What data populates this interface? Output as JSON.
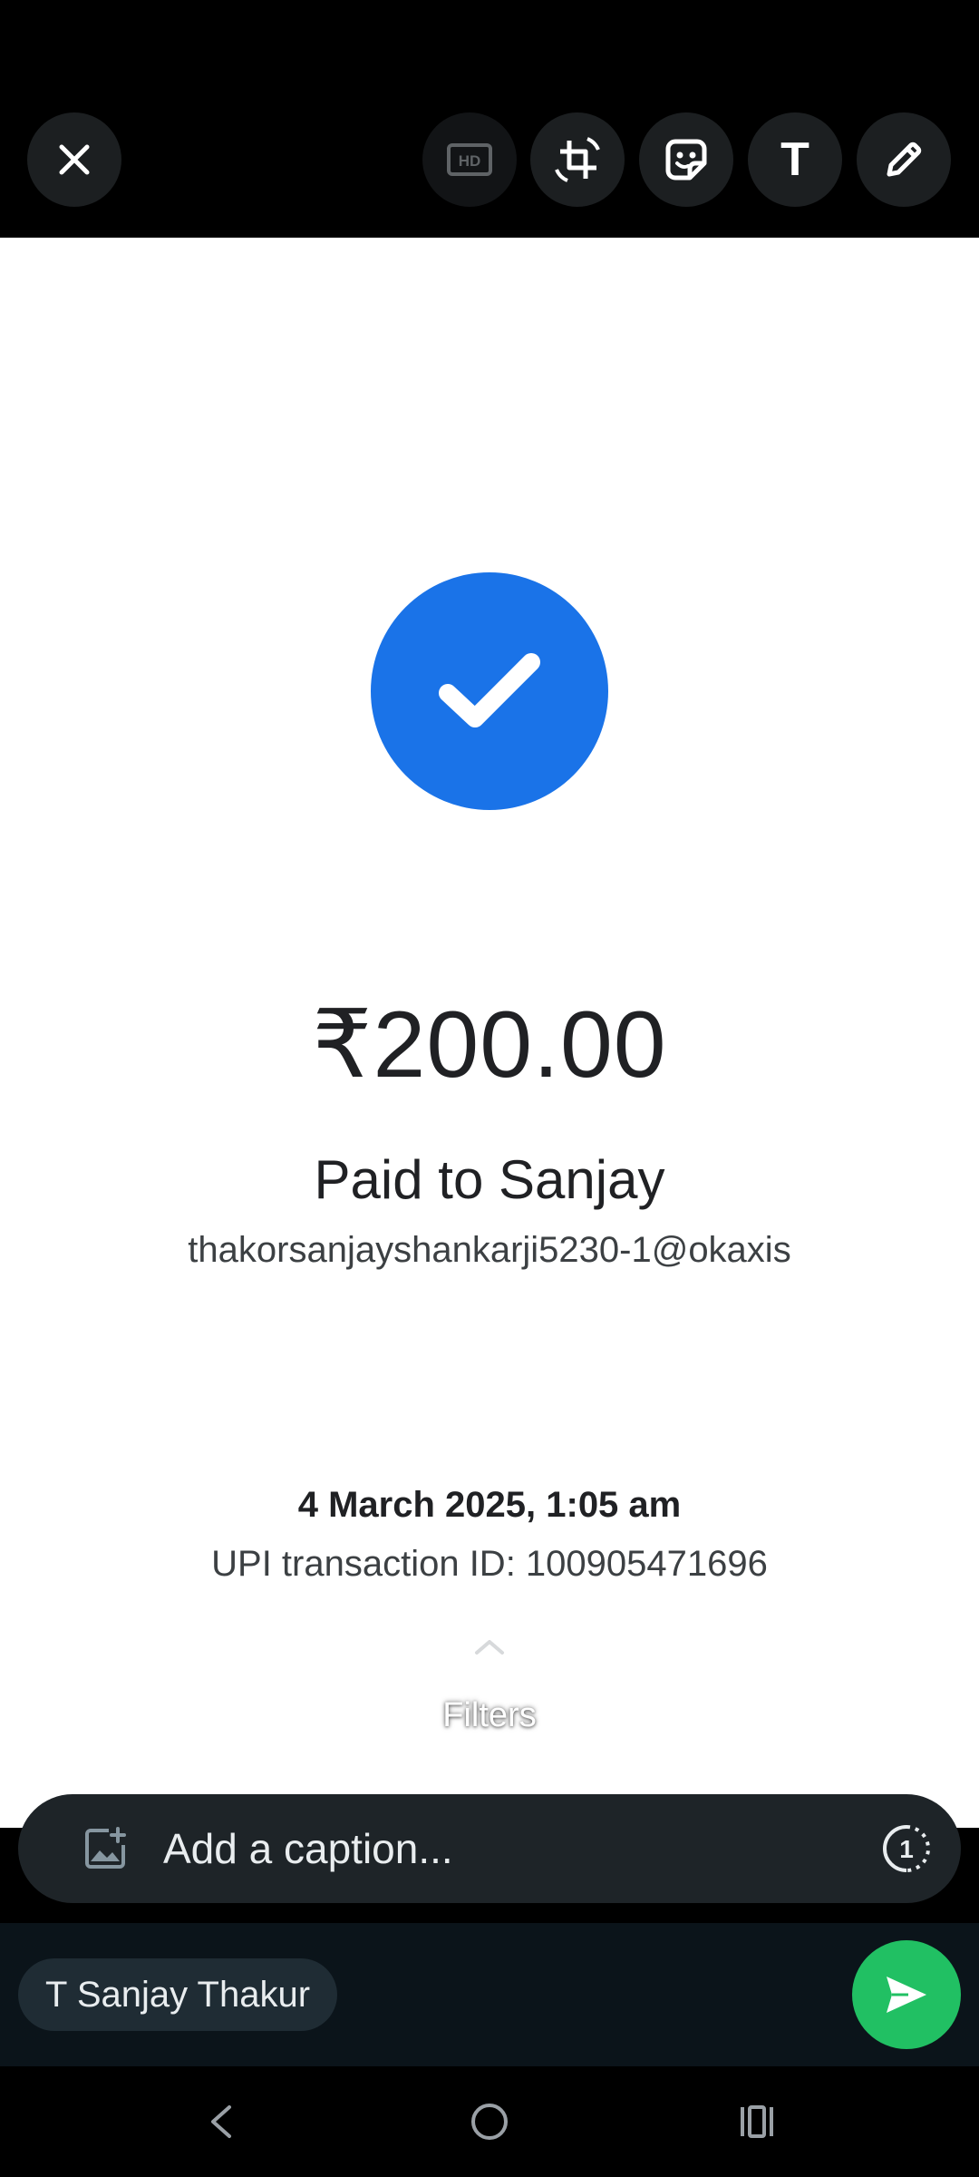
{
  "toolbar": {
    "close": "close-icon",
    "hd": "HD",
    "crop_rotate": "crop-rotate-icon",
    "sticker": "sticker-icon",
    "text": "T",
    "draw": "pencil-icon"
  },
  "receipt": {
    "status_icon": "check-icon",
    "amount": "₹200.00",
    "paid_to": "Paid to Sanjay",
    "upi_handle": "thakorsanjayshankarji5230-1@okaxis",
    "datetime": "4 March 2025, 1:05 am",
    "transaction_id": "UPI transaction ID: 100905471696"
  },
  "filters": {
    "label": "Filters",
    "icon": "chevron-up-icon"
  },
  "caption": {
    "placeholder": "Add a caption...",
    "add_status_icon": "add-image-icon",
    "view_once_icon": "view-once-icon",
    "view_once_value": "1"
  },
  "recipient": {
    "name": "T Sanjay Thakur"
  },
  "send": {
    "icon": "send-icon"
  },
  "nav": {
    "back": "back-icon",
    "home": "home-icon",
    "recents": "recents-icon"
  },
  "colors": {
    "accent_blue": "#1a73e8",
    "send_green": "#21c063",
    "toolbar_bg": "#000000",
    "bar_dark": "#0b141a"
  }
}
